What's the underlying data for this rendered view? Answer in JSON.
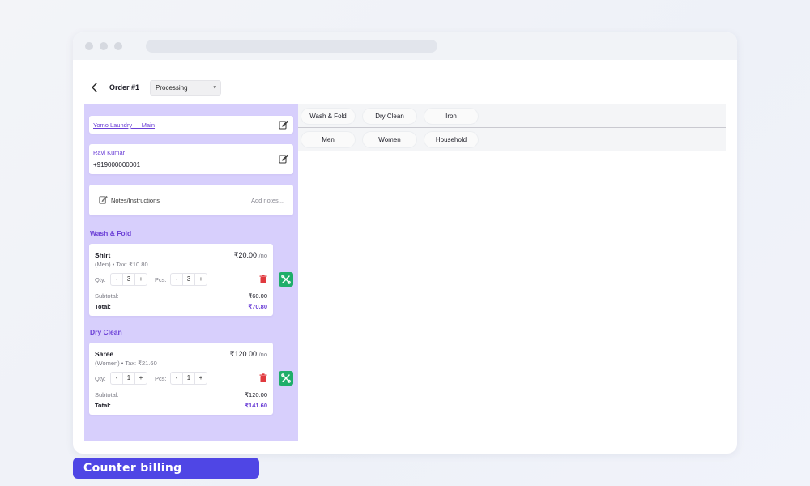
{
  "header": {
    "order_title": "Order #1",
    "status_value": "Processing",
    "status_caret": "▾"
  },
  "store": {
    "name": "Yomo Laundry — Main"
  },
  "customer": {
    "name": "Ravi Kumar",
    "phone": "+919000000001"
  },
  "notes": {
    "label": "Notes/Instructions",
    "action": "Add notes..."
  },
  "sections": [
    {
      "title": "Wash & Fold",
      "item": {
        "name": "Shirt",
        "meta": "(Men) • Tax: ₹10.80",
        "price": "₹20.00",
        "price_unit": "/no",
        "qty_label": "Qty:",
        "qty": "3",
        "pcs_label": "Pcs:",
        "pcs": "3",
        "minus": "-",
        "plus": "+",
        "subtotal_label": "Subtotal:",
        "subtotal": "₹60.00",
        "total_label": "Total:",
        "total": "₹70.80"
      }
    },
    {
      "title": "Dry Clean",
      "item": {
        "name": "Saree",
        "meta": "(Women) • Tax: ₹21.60",
        "price": "₹120.00",
        "price_unit": "/no",
        "qty_label": "Qty:",
        "qty": "1",
        "pcs_label": "Pcs:",
        "pcs": "1",
        "minus": "-",
        "plus": "+",
        "subtotal_label": "Subtotal:",
        "subtotal": "₹120.00",
        "total_label": "Total:",
        "total": "₹141.60"
      }
    }
  ],
  "service_tabs": [
    "Wash & Fold",
    "Dry Clean",
    "Iron"
  ],
  "category_tabs": [
    "Men",
    "Women",
    "Household"
  ],
  "footer": {
    "caption": "Counter billing"
  },
  "colors": {
    "accent": "#6b3fd6",
    "panel": "#d7cffc",
    "badge": "#4f46e5",
    "tool_button": "#1fae6a",
    "delete": "#e0393e"
  }
}
